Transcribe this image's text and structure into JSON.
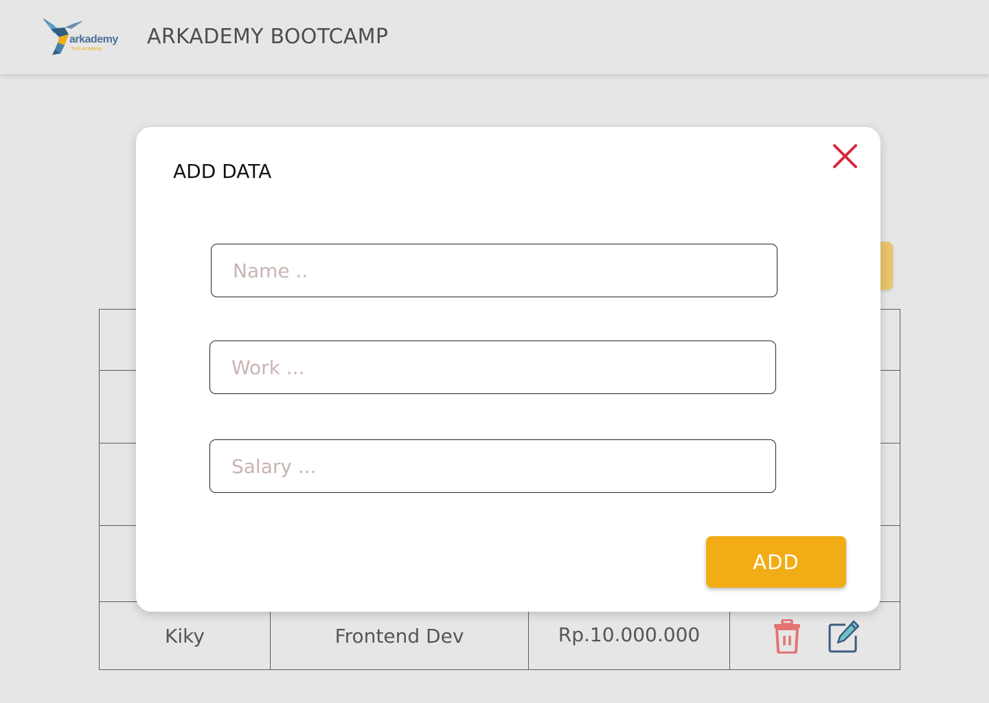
{
  "header": {
    "logo_text": "arkademy",
    "logo_subtext": "Tech Academy",
    "title": "ARKADEMY BOOTCAMP"
  },
  "table": {
    "rows": [
      {
        "name": "Kiky",
        "work": "Frontend Dev",
        "salary": "Rp.10.000.000"
      }
    ]
  },
  "modal": {
    "title": "ADD DATA",
    "fields": {
      "name_placeholder": "Name ..",
      "work_placeholder": "Work ...",
      "salary_placeholder": "Salary ..."
    },
    "submit_label": "ADD",
    "close_icon": "close-icon"
  },
  "colors": {
    "accent": "#f2ad16",
    "close": "#d7263d",
    "delete": "#e57373",
    "edit": "#3d5a80",
    "background": "#e6e6e6"
  }
}
